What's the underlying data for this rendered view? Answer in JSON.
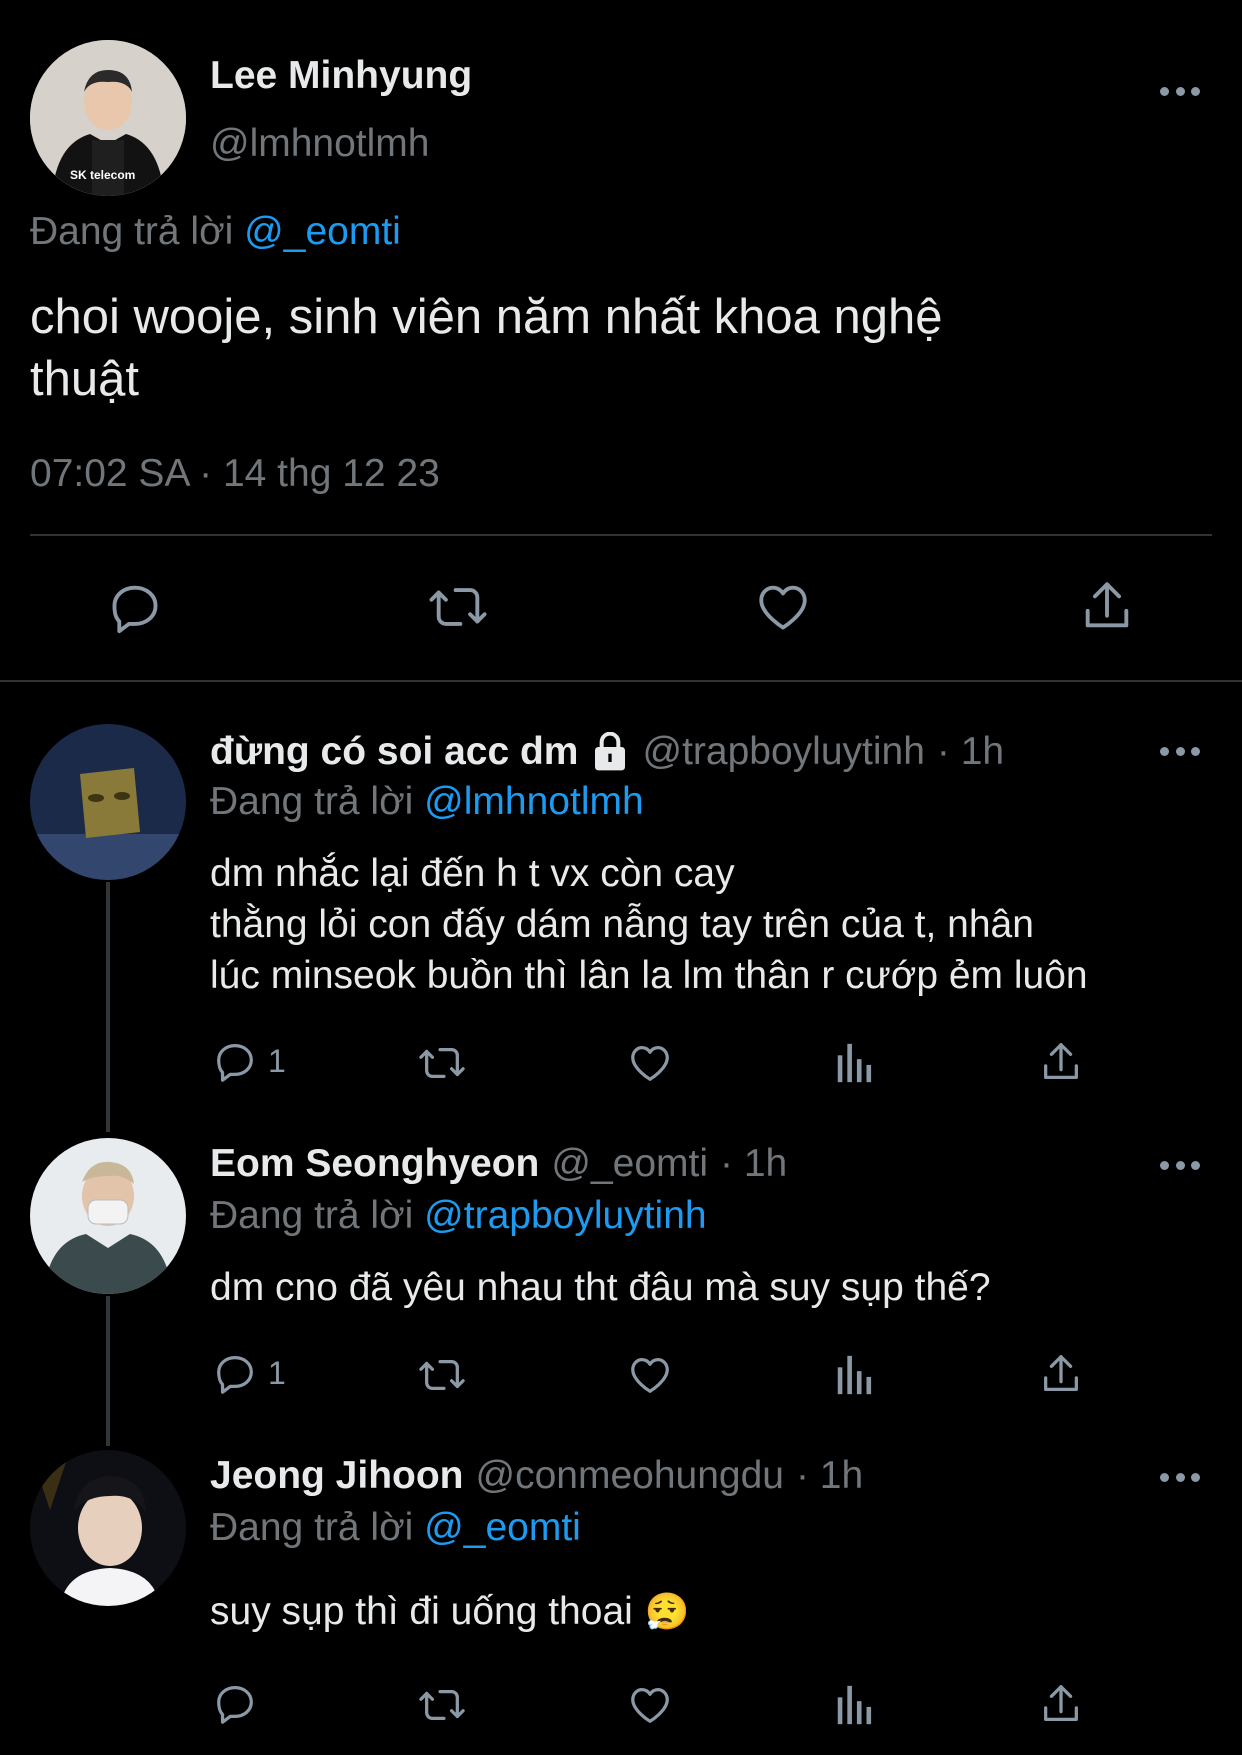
{
  "main_tweet": {
    "display_name": "Lee Minhyung",
    "handle": "@lmhnotlmh",
    "reply_prefix": "Đang trả lời",
    "reply_to": "@_eomti",
    "text_line1": "choi wooje, sinh viên năm nhất khoa nghệ",
    "text_line2": "thuật",
    "timestamp": "07:02 SA · 14 thg 12 23",
    "avatar_caption": "SK telecom"
  },
  "replies": [
    {
      "display_name": "đừng có soi acc dm",
      "handle": "@trapboyluytinh",
      "time": "· 1h",
      "reply_prefix": "Đang trả lời",
      "reply_to": "@lmhnotlmh",
      "text_lines": [
        "dm nhắc lại đến h t vx còn cay",
        "thằng lỏi con đấy dám nẫng tay trên của t, nhân",
        "lúc minseok buồn thì lân la lm thân r cướp ẻm luôn"
      ],
      "reply_count": "1"
    },
    {
      "display_name": "Eom Seonghyeon",
      "handle": "@_eomti",
      "time": "· 1h",
      "reply_prefix": "Đang trả lời",
      "reply_to": "@trapboyluytinh",
      "text_lines": [
        "dm cno đã yêu nhau tht đâu mà suy sụp thế?"
      ],
      "reply_count": "1"
    },
    {
      "display_name": "Jeong Jihoon",
      "handle": "@conmeohungdu",
      "time": "· 1h",
      "reply_prefix": "Đang trả lời",
      "reply_to": "@_eomti",
      "text_lines": [
        "suy sụp thì đi uống thoai"
      ],
      "emoji": "😮‍💨",
      "reply_count": ""
    }
  ],
  "colors": {
    "background": "#000000",
    "text": "#e7e9ea",
    "muted": "#71767b",
    "link": "#1d9bf0",
    "divider": "#2f3336"
  }
}
